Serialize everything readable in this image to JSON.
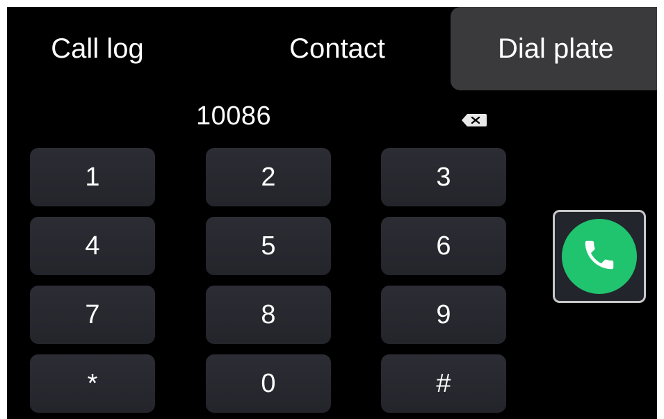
{
  "tabs": {
    "call_log": "Call log",
    "contact": "Contact",
    "dial_plate": "Dial plate"
  },
  "dialer": {
    "number": "10086",
    "backspace_icon": "backspace-icon"
  },
  "keys": [
    "1",
    "2",
    "3",
    "4",
    "5",
    "6",
    "7",
    "8",
    "9",
    "*",
    "0",
    "#"
  ],
  "call": {
    "icon": "phone-icon"
  },
  "colors": {
    "background": "#000000",
    "active_tab": "#3a3a3d",
    "key": "#2a2a31",
    "call_green": "#21c46e"
  }
}
